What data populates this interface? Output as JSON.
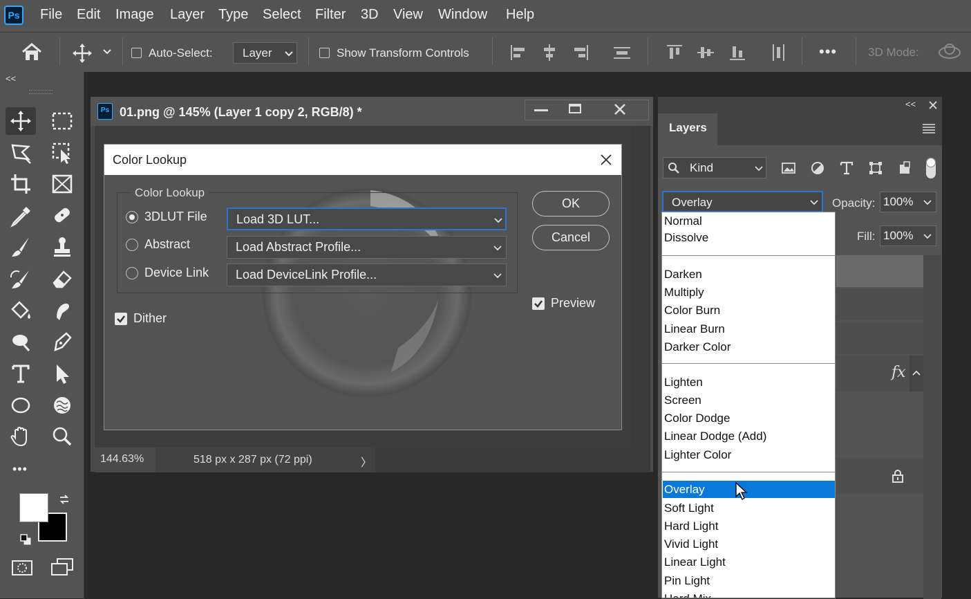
{
  "menu": {
    "logo": "Ps",
    "items": [
      "File",
      "Edit",
      "Image",
      "Layer",
      "Type",
      "Select",
      "Filter",
      "3D",
      "View",
      "Window",
      "Help"
    ]
  },
  "options": {
    "auto_select_label": "Auto-Select:",
    "auto_select_value": "Layer",
    "show_transform_label": "Show Transform Controls",
    "mode_3d_label": "3D Mode:",
    "more_label": "•••"
  },
  "tools": {
    "collapse_label": "<<",
    "more_label": "•••"
  },
  "document": {
    "icon_label": "Ps",
    "title": "01.png @ 145% (Layer 1 copy 2, RGB/8) *",
    "zoom": "144.63%",
    "size_info": "518 px x 287 px (72 ppi)",
    "status_arrow": "〉"
  },
  "dialog": {
    "title": "Color Lookup",
    "group_label": "Color Lookup",
    "options": [
      {
        "label": "3DLUT File",
        "value": "Load 3D LUT...",
        "selected": true
      },
      {
        "label": "Abstract",
        "value": "Load Abstract Profile...",
        "selected": false
      },
      {
        "label": "Device Link",
        "value": "Load DeviceLink Profile...",
        "selected": false
      }
    ],
    "ok_label": "OK",
    "cancel_label": "Cancel",
    "preview_label": "Preview",
    "dither_label": "Dither"
  },
  "layers_panel": {
    "collapse_label": "<<",
    "tab_label": "Layers",
    "kind_label": "Kind",
    "blend_mode": "Overlay",
    "opacity_label": "Opacity:",
    "opacity_value": "100%",
    "fill_label": "Fill:",
    "fill_value": "100%",
    "fx_label": "fx",
    "blend_groups": [
      [
        "Normal",
        "Dissolve"
      ],
      [
        "Darken",
        "Multiply",
        "Color Burn",
        "Linear Burn",
        "Darker Color"
      ],
      [
        "Lighten",
        "Screen",
        "Color Dodge",
        "Linear Dodge (Add)",
        "Lighter Color"
      ],
      [
        "Overlay",
        "Soft Light",
        "Hard Light",
        "Vivid Light",
        "Linear Light",
        "Pin Light",
        "Hard Mix"
      ]
    ],
    "highlighted_mode": "Overlay"
  },
  "colors": {
    "accent": "#0a78d7",
    "focus_border": "#2d74d2",
    "foreground_swatch": "#ffffff",
    "background_swatch": "#000000"
  }
}
